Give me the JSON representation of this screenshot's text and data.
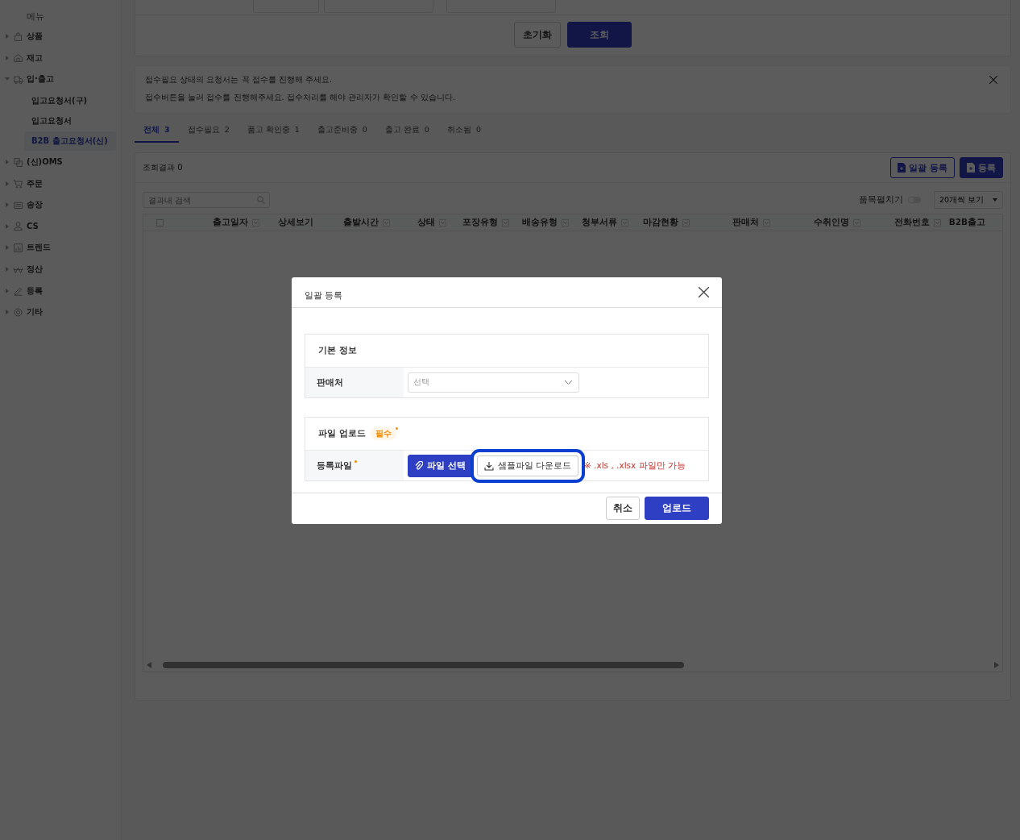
{
  "sidebar": {
    "heading": "메뉴",
    "items": [
      {
        "label": "상품",
        "expanded": false
      },
      {
        "label": "재고",
        "expanded": false
      },
      {
        "label": "입·출고",
        "expanded": true,
        "children": [
          {
            "label": "입고요청서(구)",
            "selected": false
          },
          {
            "label": "입고요청서",
            "selected": false
          },
          {
            "label": "B2B 출고요청서(신)",
            "selected": true
          }
        ]
      },
      {
        "label": "(신)OMS",
        "expanded": false
      },
      {
        "label": "주문",
        "expanded": false
      },
      {
        "label": "송장",
        "expanded": false
      },
      {
        "label": "CS",
        "expanded": false
      },
      {
        "label": "트렌드",
        "expanded": false
      },
      {
        "label": "정산",
        "expanded": false
      },
      {
        "label": "등록",
        "expanded": false
      },
      {
        "label": "기타",
        "expanded": false
      }
    ]
  },
  "filter": {
    "buttons": [
      {
        "label": "초기화",
        "kind": "secondary"
      },
      {
        "label": "조회",
        "kind": "primary"
      }
    ]
  },
  "notice": {
    "lines": [
      "접수필요 상태의 요청서는 꼭 접수를 진행해 주세요.",
      "접수버튼을 눌러 접수를 진행해주세요. 접수처리를 해야 관리자가 확인할 수 있습니다."
    ]
  },
  "tabs": [
    {
      "label": "전체",
      "count": "3",
      "selected": true
    },
    {
      "label": "접수필요",
      "count": "2",
      "selected": false
    },
    {
      "label": "품고 확인중",
      "count": "1",
      "selected": false
    },
    {
      "label": "출고준비중",
      "count": "0",
      "selected": false
    },
    {
      "label": "출고 완료",
      "count": "0",
      "selected": false
    },
    {
      "label": "취소됨",
      "count": "0",
      "selected": false
    }
  ],
  "results": {
    "title": "조회결과 0",
    "actions": [
      {
        "label": "일괄 등록",
        "kind": "outline"
      },
      {
        "label": "등록",
        "kind": "primary"
      }
    ],
    "search": {
      "placeholder": "결과내 검색"
    },
    "toggle": {
      "label": "품목펼치기",
      "on": false
    },
    "page_size": "20개씩 보기",
    "select_all": {
      "checked": false
    },
    "columns": [
      {
        "label": "출고일자",
        "filter": true
      },
      {
        "label": "상세보기",
        "filter": false
      },
      {
        "label": "출발시간",
        "filter": true
      },
      {
        "label": "상태",
        "filter": true
      },
      {
        "label": "포장유형",
        "filter": true
      },
      {
        "label": "배송유형",
        "filter": true
      },
      {
        "label": "청부서류",
        "filter": true
      },
      {
        "label": "마감현황",
        "filter": true
      },
      {
        "label": "판매처",
        "filter": true
      },
      {
        "label": "수취인명",
        "filter": true
      },
      {
        "label": "전화번호",
        "filter": true
      },
      {
        "label": "B2B출고",
        "filter": false
      }
    ]
  },
  "modal": {
    "title": "일괄 등록",
    "sections": [
      {
        "title": "기본 정보",
        "rows": [
          {
            "label": "판매처",
            "kind": "select",
            "required": false,
            "placeholder": "선택"
          }
        ]
      },
      {
        "title": "파일 업로드",
        "badge": "필수",
        "rows": [
          {
            "label": "등록파일",
            "kind": "file",
            "required": true,
            "buttons": [
              {
                "label": "파일 선택",
                "kind": "primary",
                "highlighted": false
              },
              {
                "label": "샘플파일 다운로드",
                "kind": "download",
                "highlighted": true
              }
            ],
            "note": "※ .xls , .xlsx 파일만 가능"
          }
        ]
      }
    ],
    "buttons": [
      {
        "label": "취소",
        "kind": "secondary"
      },
      {
        "label": "업로드",
        "kind": "primary"
      }
    ]
  }
}
